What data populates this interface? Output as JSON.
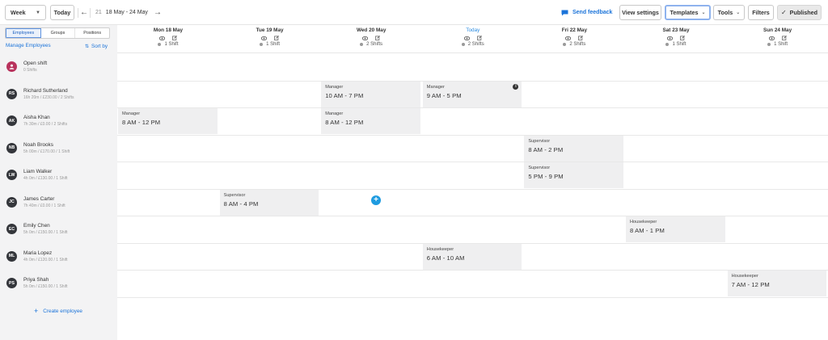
{
  "toolbar": {
    "view_select": "Week",
    "today_button": "Today",
    "week_number": "21",
    "date_range": "18 May - 24 May",
    "send_feedback": "Send feedback",
    "view_settings": "View settings",
    "templates": "Templates",
    "tools": "Tools",
    "filters": "Filters",
    "published": "Published"
  },
  "sidebar": {
    "tabs": [
      "Employees",
      "Groups",
      "Positions"
    ],
    "active_tab": "Employees",
    "manage_employees": "Manage Employees",
    "sort_by": "Sort by",
    "create_employee": "Create employee",
    "employees": [
      {
        "initials": "",
        "name": "Open shift",
        "meta": "0 Shifts",
        "open": true
      },
      {
        "initials": "RS",
        "name": "Richard Sutherland",
        "meta": "16h 20m / £230.00 / 2 Shifts"
      },
      {
        "initials": "AK",
        "name": "Aisha Khan",
        "meta": "7h 30m / £0.00 / 2 Shifts"
      },
      {
        "initials": "NB",
        "name": "Noah Brooks",
        "meta": "5h 00m / £170.00 / 1 Shift"
      },
      {
        "initials": "LW",
        "name": "Liam Walker",
        "meta": "4h 0m / £130.00 / 1 Shift"
      },
      {
        "initials": "JC",
        "name": "James Carter",
        "meta": "7h 40m / £0.00 / 1 Shift"
      },
      {
        "initials": "EC",
        "name": "Emily Chen",
        "meta": "5h 0m / £150.00 / 1 Shift"
      },
      {
        "initials": "ML",
        "name": "Maria Lopez",
        "meta": "4h 0m / £120.00 / 1 Shift"
      },
      {
        "initials": "PS",
        "name": "Priya Shah",
        "meta": "5h 0m / £150.00 / 1 Shift"
      }
    ]
  },
  "days": [
    {
      "label": "Mon 18 May",
      "shifts": "1 Shift"
    },
    {
      "label": "Tue 19 May",
      "shifts": "1 Shift"
    },
    {
      "label": "Wed 20 May",
      "shifts": "2 Shifts"
    },
    {
      "label": "Today",
      "shifts": "2 Shifts",
      "today": true
    },
    {
      "label": "Fri 22 May",
      "shifts": "2 Shifts"
    },
    {
      "label": "Sat 23 May",
      "shifts": "1 Shift"
    },
    {
      "label": "Sun 24 May",
      "shifts": "1 Shift"
    }
  ],
  "shifts": [
    {
      "row": 1,
      "day": 2,
      "position": "Manager",
      "time": "10 AM  - 7 PM"
    },
    {
      "row": 1,
      "day": 3,
      "position": "Manager",
      "time": "9 AM  - 5 PM",
      "info": true
    },
    {
      "row": 2,
      "day": 0,
      "position": "Manager",
      "time": "8 AM  - 12 PM"
    },
    {
      "row": 2,
      "day": 2,
      "position": "Manager",
      "time": "8 AM  - 12 PM"
    },
    {
      "row": 3,
      "day": 4,
      "position": "Supervisor",
      "time": "8 AM  - 2 PM"
    },
    {
      "row": 4,
      "day": 4,
      "position": "Supervisor",
      "time": "5 PM  - 9 PM"
    },
    {
      "row": 5,
      "day": 1,
      "position": "Supervisor",
      "time": "8 AM  - 4 PM"
    },
    {
      "row": 6,
      "day": 5,
      "position": "Housekeeper",
      "time": "8 AM  - 1 PM"
    },
    {
      "row": 7,
      "day": 3,
      "position": "Housekeeper",
      "time": "6 AM  - 10 AM"
    },
    {
      "row": 8,
      "day": 6,
      "position": "Housekeeper",
      "time": "7 AM  - 12 PM"
    }
  ],
  "add_shift_symbol": "+",
  "info_symbol": "i"
}
